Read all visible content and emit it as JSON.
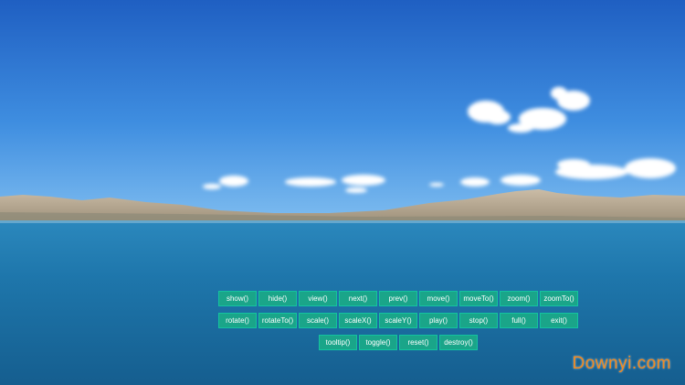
{
  "viewer": {
    "image_description_icon": "lake-landscape-image",
    "row1": [
      "show()",
      "hide()",
      "view()",
      "next()",
      "prev()",
      "move()",
      "moveTo()",
      "zoom()",
      "zoomTo()"
    ],
    "row2": [
      "rotate()",
      "rotateTo()",
      "scale()",
      "scaleX()",
      "scaleY()",
      "play()",
      "stop()",
      "full()",
      "exit()"
    ],
    "row3": [
      "tooltip()",
      "toggle()",
      "reset()",
      "destroy()"
    ]
  },
  "watermark": "Downyi.com",
  "colors": {
    "button_bg": "#1aa589",
    "button_border": "#14c3a0",
    "watermark": "#f08a21",
    "sky_top": "#1f63c4",
    "water": "#1a6fa3"
  }
}
